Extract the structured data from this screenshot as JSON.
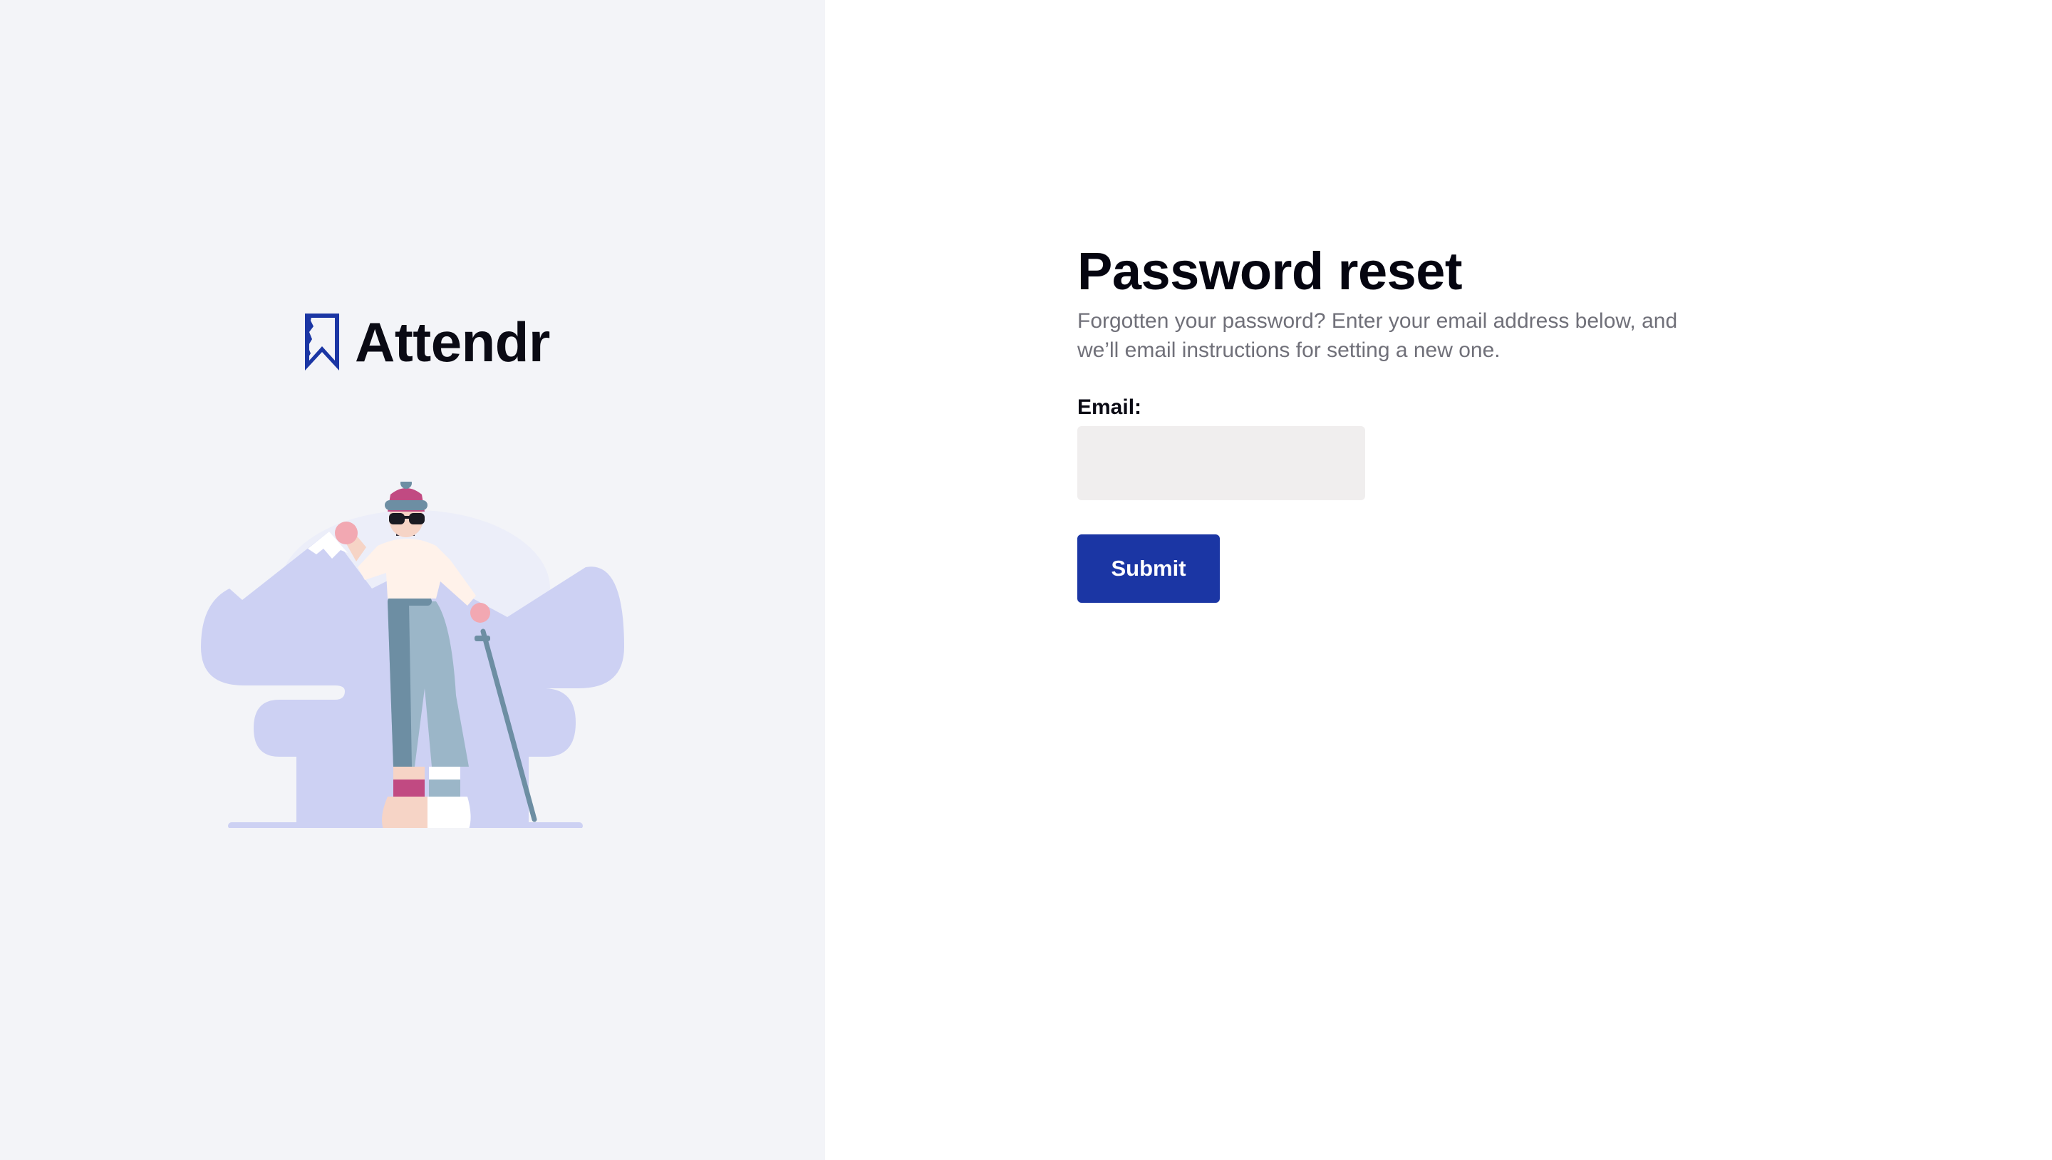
{
  "brand": {
    "name": "Attendr",
    "logo_icon": "bookmark-icon",
    "accent_color": "#1b36a4"
  },
  "illustration": {
    "icon": "skier-illustration",
    "colors": {
      "mountain": "#cdd1f3",
      "background_cloud": "#e9eaf8",
      "hat": "#c14a82",
      "pants": "#6d8ea3"
    }
  },
  "form": {
    "title": "Password reset",
    "subtitle": "Forgotten your password? Enter your email address below, and we’ll email instructions for setting a new one.",
    "email_label": "Email:",
    "email_value": "",
    "email_placeholder": "",
    "submit_label": "Submit"
  },
  "colors": {
    "left_panel_bg": "#f3f4f8",
    "input_bg": "#f0eeee",
    "button_bg": "#1b36a4",
    "subtitle_text": "#707079"
  }
}
